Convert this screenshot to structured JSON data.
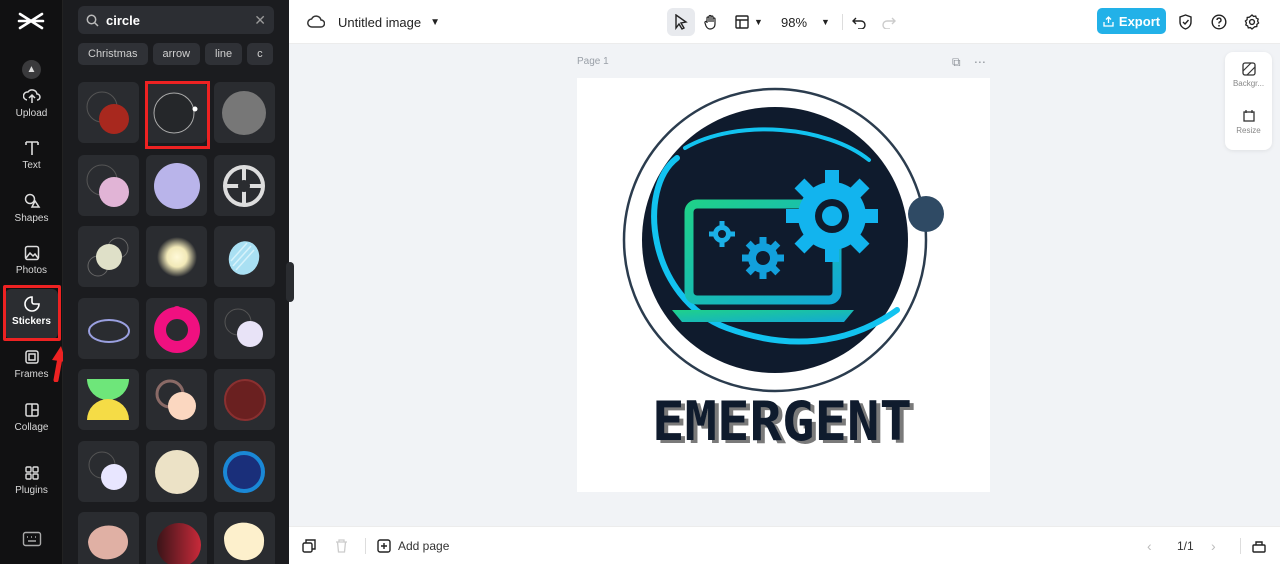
{
  "rail": {
    "items": [
      {
        "label": "Upload",
        "icon": "upload-icon"
      },
      {
        "label": "Text",
        "icon": "text-icon"
      },
      {
        "label": "Shapes",
        "icon": "shapes-icon"
      },
      {
        "label": "Photos",
        "icon": "photos-icon"
      },
      {
        "label": "Stickers",
        "icon": "stickers-icon"
      },
      {
        "label": "Frames",
        "icon": "frames-icon"
      },
      {
        "label": "Collage",
        "icon": "collage-icon"
      },
      {
        "label": "Plugins",
        "icon": "plugins-icon"
      }
    ],
    "active": "Stickers"
  },
  "panel": {
    "search_value": "circle",
    "chips": [
      "Christmas",
      "arrow",
      "line",
      "c"
    ]
  },
  "topbar": {
    "title": "Untitled image",
    "zoom": "98%",
    "export_label": "Export"
  },
  "canvas": {
    "page_label": "Page 1",
    "logo_text": "EMERGENT"
  },
  "right_panel": {
    "background_label": "Backgr...",
    "resize_label": "Resize"
  },
  "bottombar": {
    "add_page_label": "Add page",
    "page_counter": "1/1"
  },
  "colors": {
    "accent": "#22b1e8",
    "highlight": "#e22222",
    "rail_bg": "#111112",
    "panel_bg": "#1b1c1f",
    "logo_dark": "#0f1b2d",
    "logo_cyan": "#12c3f0",
    "logo_green": "#1fd18a"
  }
}
